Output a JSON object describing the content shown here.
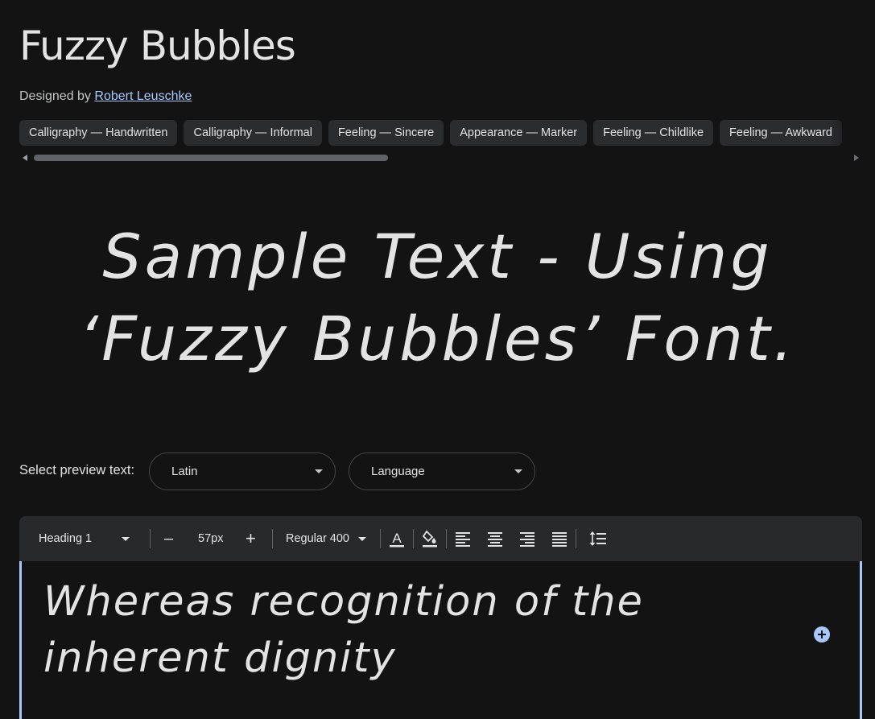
{
  "font": {
    "title": "Fuzzy Bubbles",
    "designed_by_label": "Designed by",
    "designer": "Robert Leuschke"
  },
  "tags": [
    "Calligraphy — Handwritten",
    "Calligraphy — Informal",
    "Feeling — Sincere",
    "Appearance — Marker",
    "Feeling — Childlike",
    "Feeling — Awkward"
  ],
  "sample_text": "Sample Text - Using ‘Fuzzy Bubbles’ Font.",
  "preview": {
    "label": "Select preview text:",
    "script_value": "Latin",
    "language_value": "Language"
  },
  "toolbar": {
    "style_value": "Heading 1",
    "size_value": "57px",
    "weight_value": "Regular 400",
    "decrease_symbol": "–",
    "increase_symbol": "+"
  },
  "editor_text": "Whereas recognition of the inherent dignity",
  "icons": {
    "text_color": "text-color-icon",
    "highlight": "fill-color-icon",
    "align_left": "align-left-icon",
    "align_center": "align-center-icon",
    "align_right": "align-right-icon",
    "justify": "justify-icon",
    "line_height": "line-spacing-icon",
    "add": "add-circle-icon"
  },
  "colors": {
    "background": "#131314",
    "accent": "#a8c7fa",
    "chip": "#2b2c2e",
    "toolbar": "#28292a"
  }
}
